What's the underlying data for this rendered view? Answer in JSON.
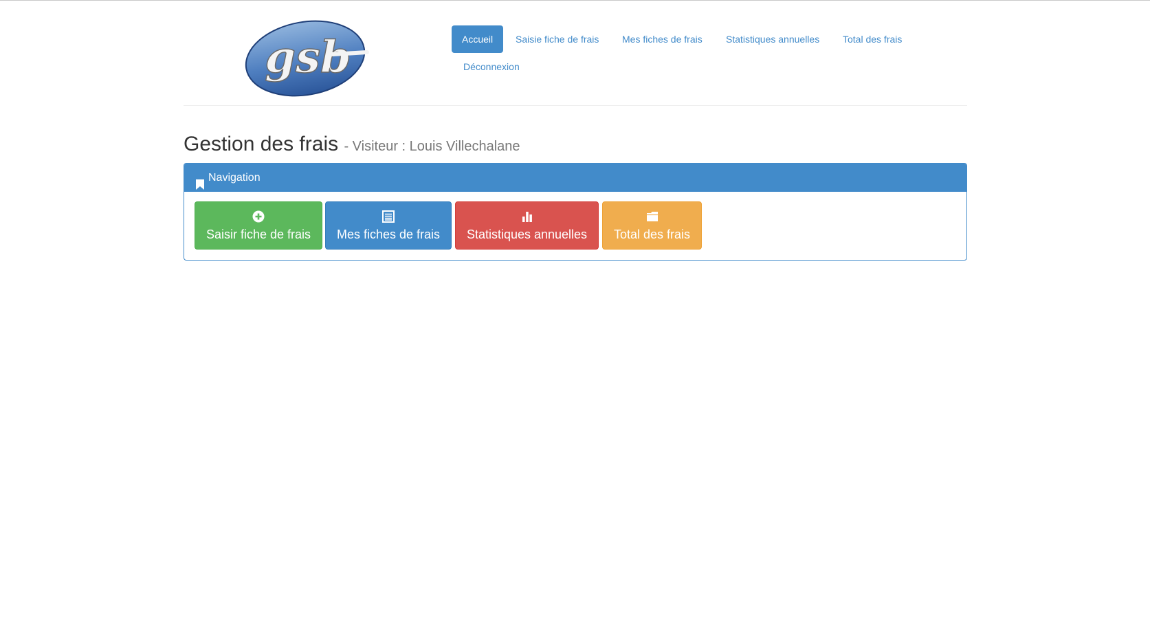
{
  "header": {
    "logo_text": "gsb",
    "nav": [
      {
        "label": "Accueil",
        "active": true
      },
      {
        "label": "Saisie fiche de frais",
        "active": false
      },
      {
        "label": "Mes fiches de frais",
        "active": false
      },
      {
        "label": "Statistiques annuelles",
        "active": false
      },
      {
        "label": "Total des frais",
        "active": false
      },
      {
        "label": "Déconnexion",
        "active": false
      }
    ]
  },
  "page": {
    "title": "Gestion des frais",
    "subtitle": "- Visiteur : Louis Villechalane"
  },
  "panel": {
    "heading": "Navigation",
    "heading_icon": "bookmark-icon",
    "tiles": [
      {
        "label": "Saisir fiche de frais",
        "icon": "plus-circle-icon",
        "color": "#5cb85c"
      },
      {
        "label": "Mes fiches de frais",
        "icon": "list-icon",
        "color": "#428bca"
      },
      {
        "label": "Statistiques annuelles",
        "icon": "bar-chart-icon",
        "color": "#d9534f"
      },
      {
        "label": "Total des frais",
        "icon": "folder-icon",
        "color": "#f0ad4e"
      }
    ]
  },
  "colors": {
    "primary": "#428bca",
    "success": "#5cb85c",
    "danger": "#d9534f",
    "warning": "#f0ad4e"
  }
}
